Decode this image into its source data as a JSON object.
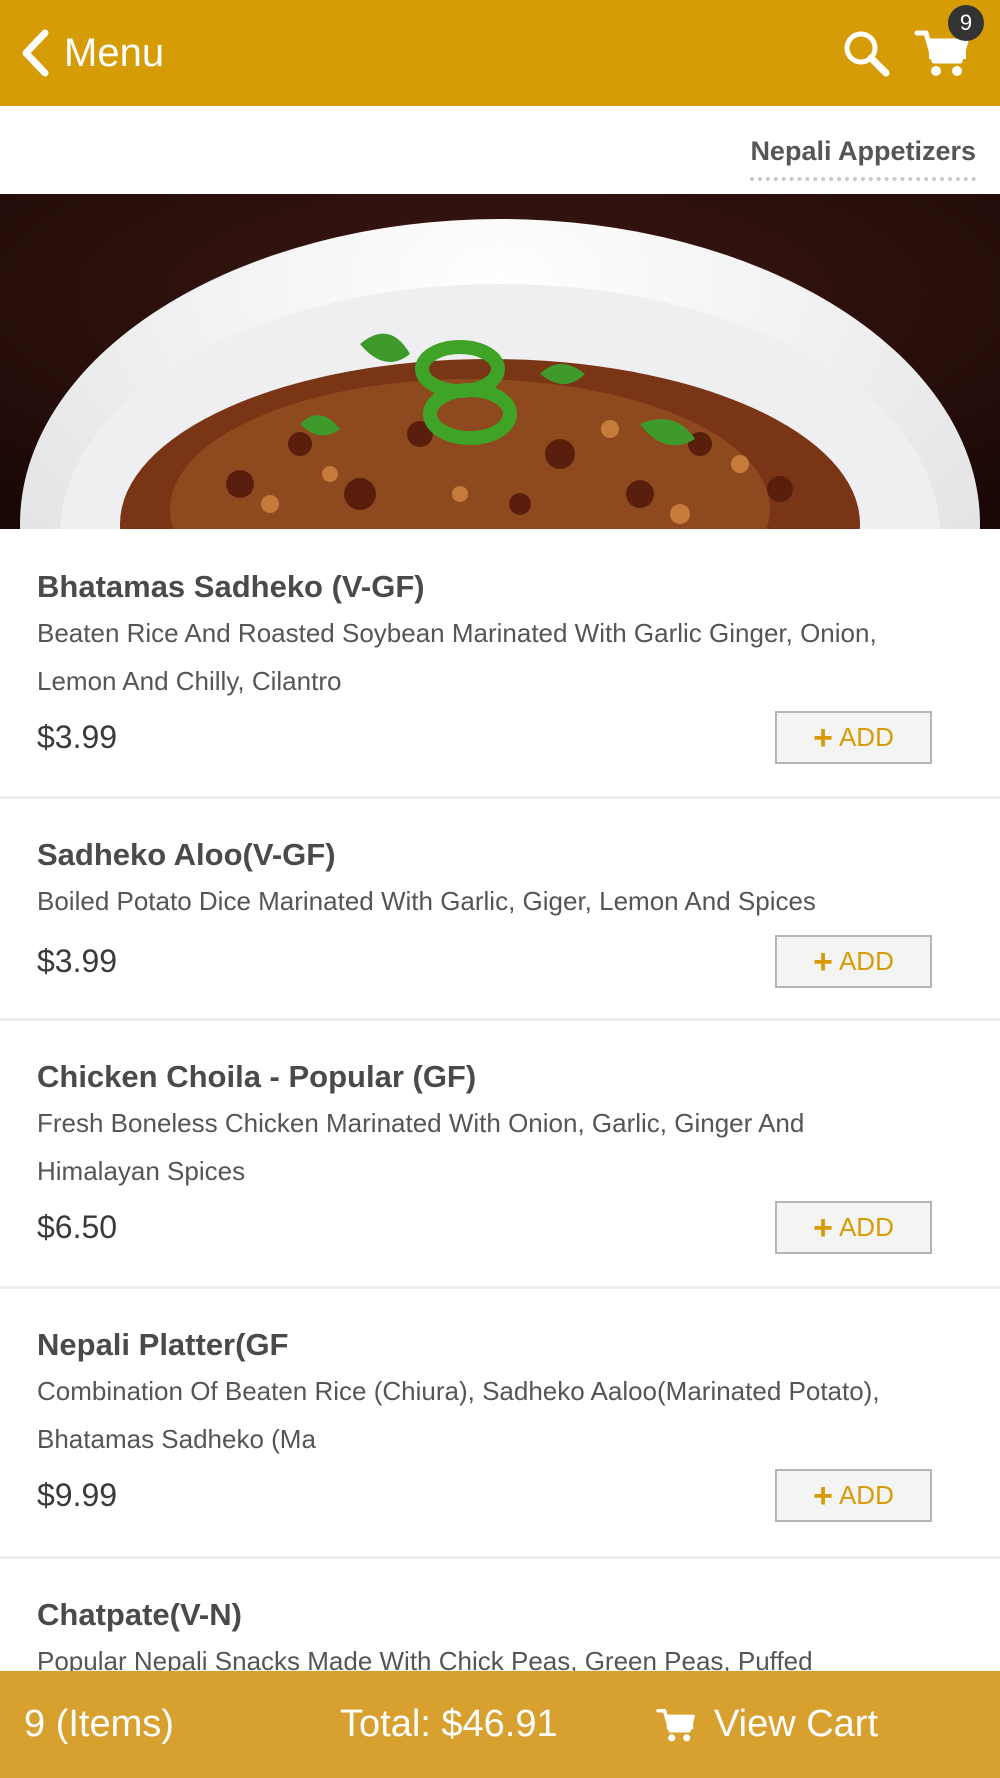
{
  "header": {
    "back_label": "Menu",
    "cart_count": "9",
    "icons": {
      "back": "chevron-left-icon",
      "search": "search-icon",
      "cart": "cart-icon"
    }
  },
  "category": {
    "active_tab": "Nepali Appetizers"
  },
  "hero_image": {
    "subject": "food-photo"
  },
  "items": [
    {
      "name": "Bhatamas Sadheko (V-GF)",
      "description": "Beaten Rice And Roasted Soybean Marinated With Garlic Ginger, Onion, Lemon And Chilly, Cilantro",
      "price": "$3.99",
      "add_label": "ADD"
    },
    {
      "name": "Sadheko Aloo(V-GF)",
      "description": "Boiled Potato Dice Marinated With Garlic, Giger, Lemon And Spices",
      "price": "$3.99",
      "add_label": "ADD"
    },
    {
      "name": "Chicken Choila - Popular (GF)",
      "description": "Fresh Boneless Chicken Marinated With Onion, Garlic, Ginger And Himalayan Spices",
      "price": "$6.50",
      "add_label": "ADD"
    },
    {
      "name": "Nepali Platter(GF",
      "description": "Combination Of Beaten Rice (Chiura), Sadheko Aaloo(Marinated Potato), Bhatamas Sadheko (Ma",
      "price": "$9.99",
      "add_label": "ADD"
    },
    {
      "name": "Chatpate(V-N)",
      "description": "Popular Nepali Snacks Made With Chick Peas, Green Peas, Puffed"
    }
  ],
  "footer": {
    "items_count": "9 (Items)",
    "total": "Total: $46.91",
    "view_cart_label": "View Cart"
  },
  "colors": {
    "brand": "#d69c06",
    "footer": "#d8a02e",
    "badge": "#333333"
  }
}
